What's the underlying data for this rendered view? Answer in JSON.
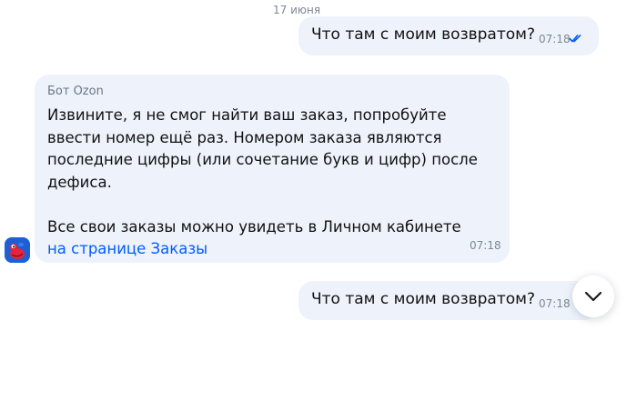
{
  "chat": {
    "date": "17 июня",
    "messages": [
      {
        "direction": "outgoing",
        "text": "Что там с моим возвратом?",
        "time": "07:18",
        "status": "read-double-check"
      },
      {
        "direction": "incoming",
        "sender": "Бот Ozon",
        "paragraph_1": "Извините, я не смог найти ваш заказ, попробуйте ввести номер ещё раз. Номером заказа являются последние цифры (или сочетание букв и цифр) после дефиса.",
        "paragraph_2_text": "Все свои заказы можно увидеть в Личном кабинете ",
        "paragraph_2_link": "на странице Заказы",
        "time": "07:18",
        "avatar": "ozon-bot-mascot-icon"
      },
      {
        "direction": "outgoing",
        "text": "Что там с моим возвратом?",
        "time": "07:18",
        "status": "sent"
      }
    ]
  },
  "scroll_down_icon": "chevron-down-icon",
  "colors": {
    "bubble": "#eef3fb",
    "link": "#005bff",
    "check": "#005bff",
    "meta": "#7d8797",
    "avatar": "#1f5fd6"
  }
}
